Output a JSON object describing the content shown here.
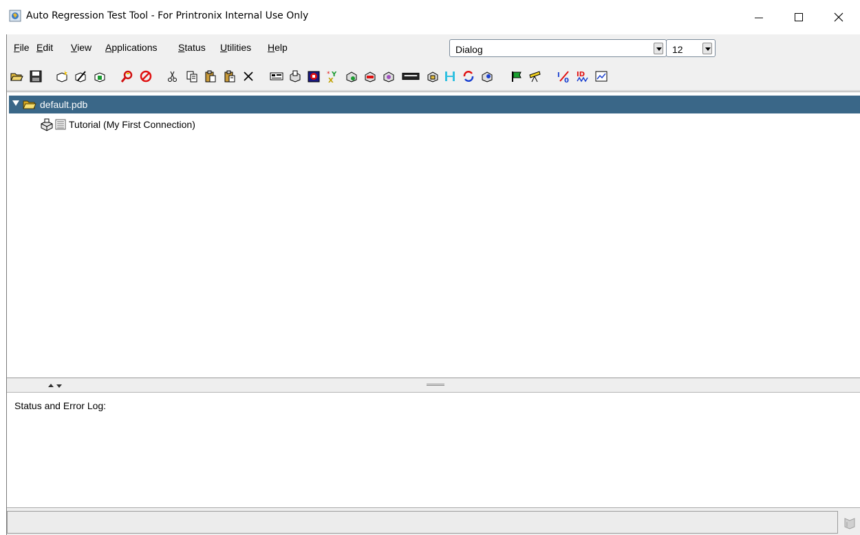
{
  "window": {
    "title": "Auto Regression Test Tool - For Printronix Internal Use Only"
  },
  "menu": {
    "items": [
      {
        "mnemonic": "F",
        "rest": "ile"
      },
      {
        "mnemonic": "E",
        "rest": "dit"
      },
      {
        "mnemonic": "V",
        "rest": "iew"
      },
      {
        "mnemonic": "A",
        "rest": "pplications"
      },
      {
        "mnemonic": "S",
        "rest": "tatus"
      },
      {
        "mnemonic": "U",
        "rest": "tilities"
      },
      {
        "mnemonic": "H",
        "rest": "elp"
      }
    ],
    "font_name": "Dialog",
    "font_size": "12"
  },
  "toolbar": {
    "icons": [
      "open-folder-icon",
      "save-icon",
      "new-connection-icon",
      "edit-connection-icon",
      "connect-icon",
      "find-icon",
      "stop-icon",
      "cut-icon",
      "copy-icon",
      "paste-icon",
      "paste-special-icon",
      "delete-icon",
      "terminal-icon",
      "printer-config-icon",
      "app-icon",
      "xy-icon",
      "printer-a-icon",
      "printer-b-icon",
      "printer-c-icon",
      "keyboard-icon",
      "printer-d-icon",
      "compare-icon",
      "refresh-icon",
      "printer-e-icon",
      "flag-icon",
      "telescope-icon",
      "percent-icon",
      "id-icon",
      "graph-icon"
    ]
  },
  "tree": {
    "root_label": "default.pdb",
    "child_label": "Tutorial (My First Connection)"
  },
  "log": {
    "label": "Status and Error Log:"
  },
  "colors": {
    "selection": "#3a6788",
    "background": "#f0f0f0"
  }
}
